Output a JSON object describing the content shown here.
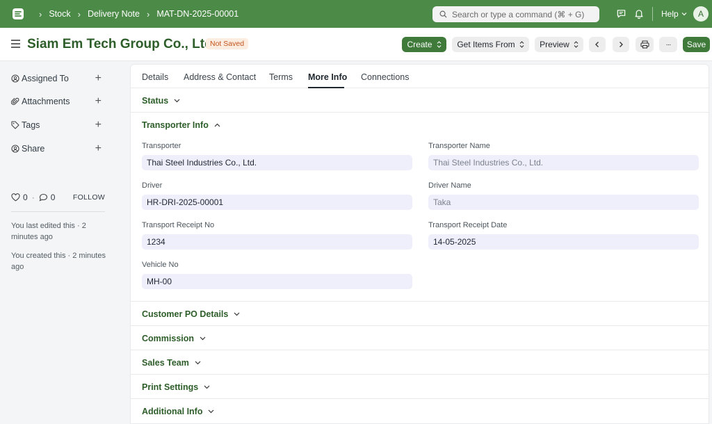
{
  "navbar": {
    "breadcrumbs": [
      "Stock",
      "Delivery Note",
      "MAT-DN-2025-00001"
    ],
    "search_placeholder": "Search or type a command (⌘ + G)",
    "help_label": "Help",
    "avatar_initial": "A",
    "bg_color": "#4c8a47"
  },
  "header": {
    "title": "Siam Em Tech Group Co., Ltd.",
    "status_badge": "Not Saved",
    "create_label": "Create",
    "get_items_label": "Get Items From",
    "preview_label": "Preview",
    "more_label": "···",
    "save_label": "Save"
  },
  "sidebar": {
    "items": [
      {
        "label": "Assigned To",
        "icon": "assign-icon"
      },
      {
        "label": "Attachments",
        "icon": "paperclip-icon"
      },
      {
        "label": "Tags",
        "icon": "tag-icon"
      },
      {
        "label": "Share",
        "icon": "share-icon"
      }
    ],
    "likes": "0",
    "comments": "0",
    "follow_label": "FOLLOW",
    "last_edited": "You last edited this · 2 minutes ago",
    "created": "You created this · 2 minutes ago"
  },
  "tabs": [
    "Details",
    "Address & Contact",
    "Terms",
    "More Info",
    "Connections"
  ],
  "active_tab": "More Info",
  "sections": {
    "status": "Status",
    "transporter_info": "Transporter Info",
    "customer_po": "Customer PO Details",
    "commission": "Commission",
    "sales_team": "Sales Team",
    "print_settings": "Print Settings",
    "additional_info": "Additional Info"
  },
  "fields": {
    "transporter": {
      "label": "Transporter",
      "value": "Thai Steel Industries Co., Ltd."
    },
    "transporter_name": {
      "label": "Transporter Name",
      "value": "Thai Steel Industries Co., Ltd."
    },
    "driver": {
      "label": "Driver",
      "value": "HR-DRI-2025-00001"
    },
    "driver_name": {
      "label": "Driver Name",
      "value": "Taka"
    },
    "transport_receipt_no": {
      "label": "Transport Receipt No",
      "value": "1234"
    },
    "transport_receipt_date": {
      "label": "Transport Receipt Date",
      "value": "14-05-2025"
    },
    "vehicle_no": {
      "label": "Vehicle No",
      "value": "MH-00"
    }
  }
}
